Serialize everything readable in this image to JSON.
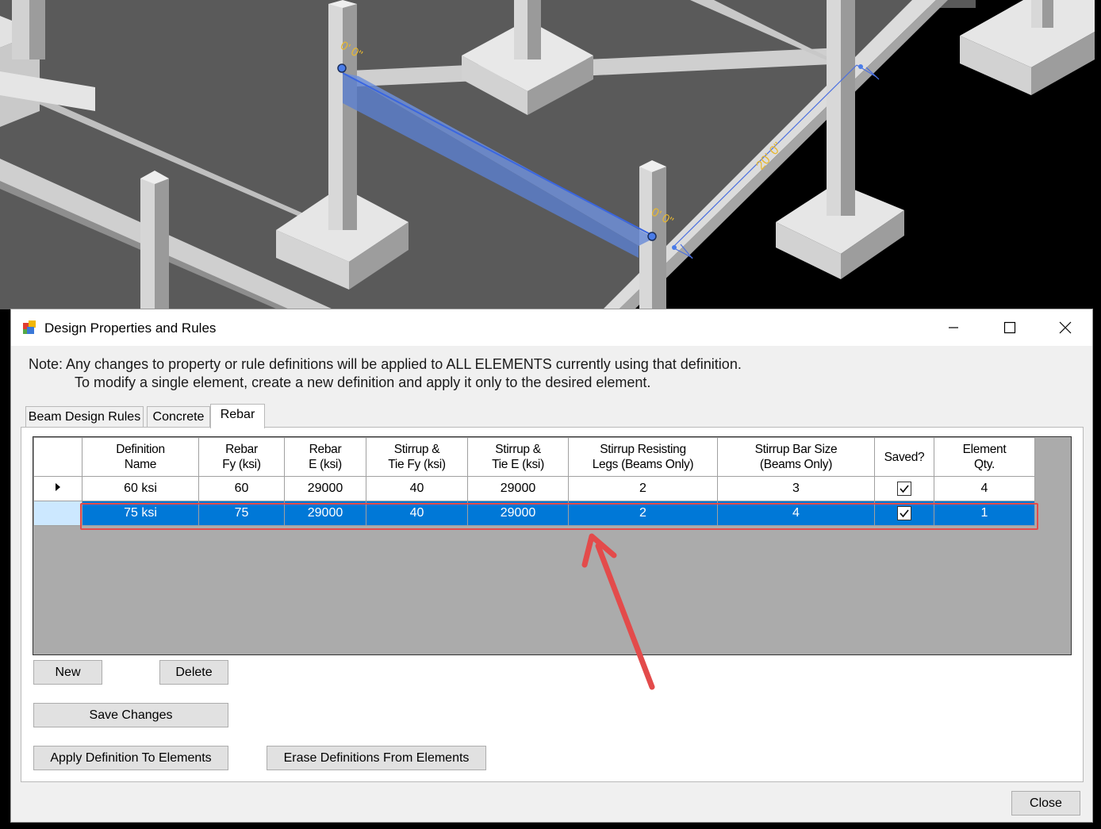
{
  "viewport": {
    "dimension_top": "0' 0\"",
    "dimension_mid": "0' 0\"",
    "dimension_span": "20' 0\""
  },
  "dialog": {
    "title": "Design Properties and Rules",
    "note_line1": "Note:  Any changes to property or rule definitions will be applied to ALL ELEMENTS currently using that definition.",
    "note_line2": "To modify a single element, create a new definition and apply it only to the desired element.",
    "tabs": [
      {
        "label": "Beam Design Rules",
        "active": false
      },
      {
        "label": "Concrete",
        "active": false
      },
      {
        "label": "Rebar",
        "active": true
      }
    ],
    "table": {
      "headers": [
        [
          "Definition",
          "Name"
        ],
        [
          "Rebar",
          "Fy (ksi)"
        ],
        [
          "Rebar",
          "E (ksi)"
        ],
        [
          "Stirrup &",
          "Tie Fy (ksi)"
        ],
        [
          "Stirrup &",
          "Tie E (ksi)"
        ],
        [
          "Stirrup Resisting",
          "Legs (Beams Only)"
        ],
        [
          "Stirrup Bar Size",
          "(Beams Only)"
        ],
        [
          "Saved?",
          ""
        ],
        [
          "Element",
          "Qty."
        ]
      ],
      "rows": [
        {
          "cells": [
            "60 ksi",
            "60",
            "29000",
            "40",
            "29000",
            "2",
            "3"
          ],
          "saved": true,
          "qty": "4",
          "selected": false
        },
        {
          "cells": [
            "75 ksi",
            "75",
            "29000",
            "40",
            "29000",
            "2",
            "4"
          ],
          "saved": true,
          "qty": "1",
          "selected": true
        }
      ]
    },
    "buttons": {
      "new": "New",
      "delete": "Delete",
      "save_changes": "Save Changes",
      "apply": "Apply Definition To Elements",
      "erase": "Erase Definitions From Elements",
      "close": "Close"
    },
    "colors": {
      "selection": "#0078d7",
      "highlight": "#e34b4b",
      "accent_blue": "#5b8ff0"
    }
  }
}
